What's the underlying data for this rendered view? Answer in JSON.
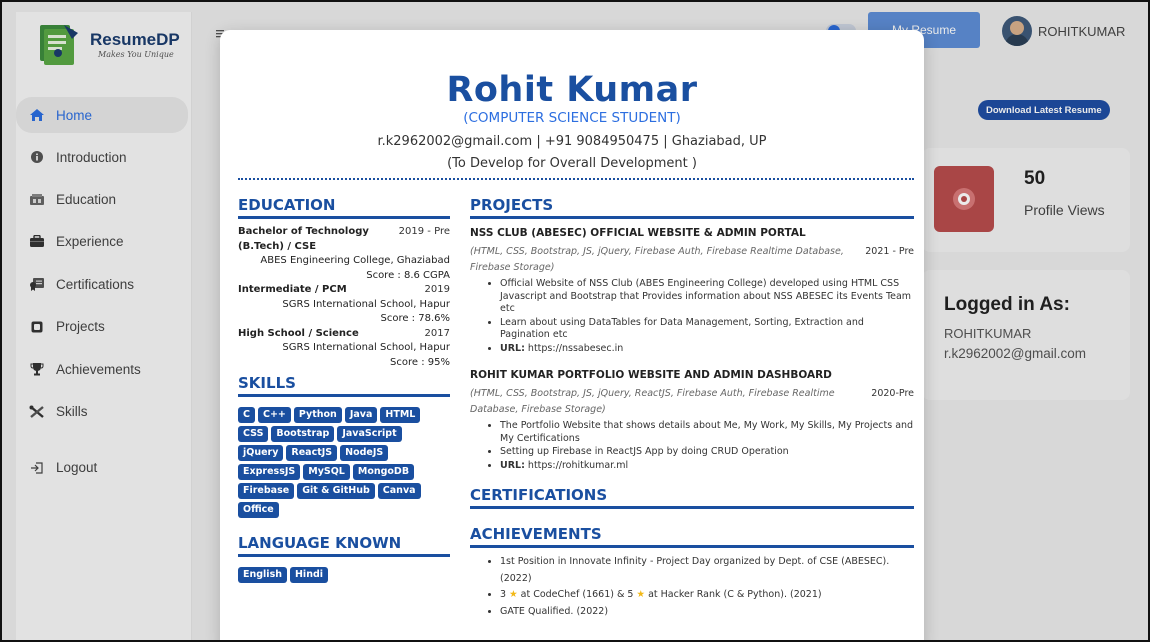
{
  "app": {
    "logo_name": "ResumeDP",
    "logo_tagline": "Makes You Unique"
  },
  "sidebar": {
    "items": [
      {
        "label": "Home",
        "icon": "home-icon",
        "active": true
      },
      {
        "label": "Introduction",
        "icon": "info-icon"
      },
      {
        "label": "Education",
        "icon": "education-icon"
      },
      {
        "label": "Experience",
        "icon": "briefcase-icon"
      },
      {
        "label": "Certifications",
        "icon": "certificate-icon"
      },
      {
        "label": "Projects",
        "icon": "projects-icon"
      },
      {
        "label": "Achievements",
        "icon": "trophy-icon"
      },
      {
        "label": "Skills",
        "icon": "tools-icon"
      }
    ],
    "logout_label": "Logout"
  },
  "topbar": {
    "my_resume_label": "My Resume",
    "username": "ROHITKUMAR"
  },
  "dashboard": {
    "download_label": "Download Latest Resume",
    "views_count": "50",
    "views_label": "Profile Views",
    "logged_title": "Logged in As:",
    "logged_user": "ROHITKUMAR",
    "logged_email": "r.k2962002@gmail.com"
  },
  "resume": {
    "name": "Rohit Kumar",
    "role": "(COMPUTER SCIENCE STUDENT)",
    "contact": "r.k2962002@gmail.com | +91 9084950475 | Ghaziabad, UP",
    "objective": "(To Develop for Overall Development )",
    "education_heading": "EDUCATION",
    "education": [
      {
        "degree": "Bachelor of Technology (B.Tech) / CSE",
        "year": "2019 - Pre",
        "institute": "ABES Engineering College, Ghaziabad",
        "score": "Score : 8.6 CGPA"
      },
      {
        "degree": "Intermediate / PCM",
        "year": "2019",
        "institute": "SGRS International School, Hapur",
        "score": "Score : 78.6%"
      },
      {
        "degree": "High School / Science",
        "year": "2017",
        "institute": "SGRS International School, Hapur",
        "score": "Score : 95%"
      }
    ],
    "skills_heading": "SKILLS",
    "skills": [
      "C",
      "C++",
      "Python",
      "Java",
      "HTML",
      "CSS",
      "Bootstrap",
      "JavaScript",
      "jQuery",
      "ReactJS",
      "NodeJS",
      "ExpressJS",
      "MySQL",
      "MongoDB",
      "Firebase",
      "Git & GitHub",
      "Canva",
      "Office"
    ],
    "language_heading": "LANGUAGE KNOWN",
    "languages": [
      "English",
      "Hindi"
    ],
    "projects_heading": "PROJECTS",
    "projects": [
      {
        "title": "NSS CLUB (ABESEC) OFFICIAL WEBSITE & ADMIN PORTAL",
        "tech": "(HTML, CSS, Bootstrap, JS, jQuery, Firebase Auth, Firebase Realtime Database, Firebase Storage)",
        "year": "2021 - Pre",
        "bullet1": "Official Website of NSS Club (ABES Engineering College) developed using HTML CSS Javascript and Bootstrap that Provides information about NSS ABESEC its Events Team etc",
        "bullet2": "Learn about using DataTables for Data Management, Sorting, Extraction and Pagination etc",
        "url_label": "URL:",
        "url": "https://nssabesec.in"
      },
      {
        "title": "ROHIT KUMAR PORTFOLIO WEBSITE AND ADMIN DASHBOARD",
        "tech": "(HTML, CSS, Bootstrap, JS, jQuery, ReactJS, Firebase Auth, Firebase Realtime Database, Firebase Storage)",
        "year": "2020-Pre",
        "bullet1": "The Portfolio Website that shows details about Me, My Work, My Skills, My Projects and My Certifications",
        "bullet2": "Setting up Firebase in ReactJS App by doing CRUD Operation",
        "url_label": "URL:",
        "url": "https://rohitkumar.ml"
      }
    ],
    "certifications_heading": "CERTIFICATIONS",
    "achievements_heading": "ACHIEVEMENTS",
    "achievements": {
      "a1": "1st Position in Innovate Infinity - Project Day organized by Dept. of CSE (ABESEC). (2022)",
      "a2_part1": "3",
      "a2_part2": "at CodeChef (1661) & 5",
      "a2_part3": "at Hacker Rank (C & Python). (2021)",
      "a3": "GATE Qualified. (2022)"
    }
  },
  "colors": {
    "brand_blue": "#1a4fa0",
    "accent_blue": "#2c6ee0",
    "views_red": "#b84c4c"
  }
}
